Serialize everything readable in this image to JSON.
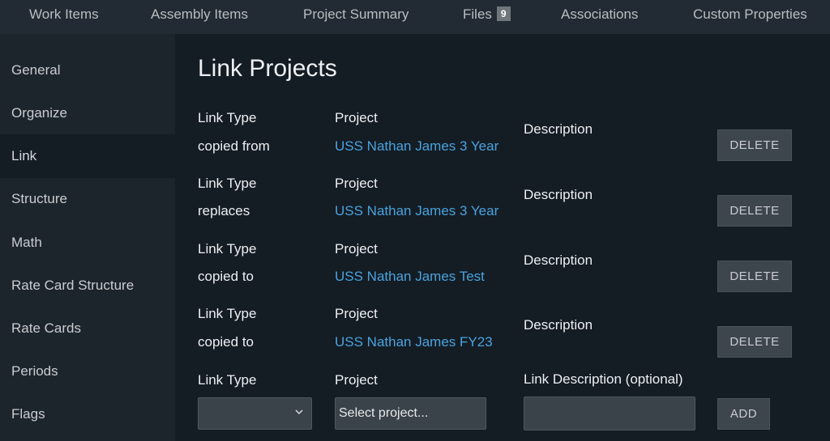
{
  "topnav": {
    "tabs": [
      {
        "label": "Work Items"
      },
      {
        "label": "Assembly Items"
      },
      {
        "label": "Project Summary"
      },
      {
        "label": "Files",
        "badge": "9"
      },
      {
        "label": "Associations"
      },
      {
        "label": "Custom Properties"
      }
    ]
  },
  "sidebar": {
    "active": "Link",
    "items": [
      {
        "label": "General"
      },
      {
        "label": "Organize"
      },
      {
        "label": "Link"
      },
      {
        "label": "Structure"
      },
      {
        "label": "Math"
      },
      {
        "label": "Rate Card Structure"
      },
      {
        "label": "Rate Cards"
      },
      {
        "label": "Periods"
      },
      {
        "label": "Flags"
      }
    ]
  },
  "main": {
    "title": "Link Projects",
    "link_type_label": "Link Type",
    "project_label": "Project",
    "description_label": "Description",
    "delete_label": "DELETE",
    "links": [
      {
        "link_type": "copied from",
        "project": "USS Nathan James 3 Year"
      },
      {
        "link_type": "replaces",
        "project": "USS Nathan James 3 Year"
      },
      {
        "link_type": "copied to",
        "project": "USS Nathan James Test"
      },
      {
        "link_type": "copied to",
        "project": "USS Nathan James FY23"
      }
    ],
    "new_link": {
      "link_type_label": "Link Type",
      "project_label": "Project",
      "description_label": "Link Description (optional)",
      "link_type_value": "",
      "project_placeholder": "Select project...",
      "description_value": "",
      "add_label": "ADD"
    }
  },
  "colors": {
    "background": "#141c24",
    "sidebar": "#1d252c",
    "topnav": "#222b33",
    "link": "#4aa3de",
    "button": "#3e464d"
  }
}
